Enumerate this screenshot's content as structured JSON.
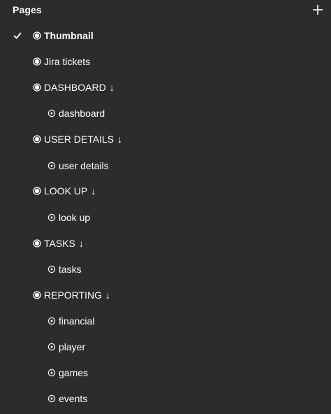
{
  "panel": {
    "title": "Pages",
    "add_icon": "plus-icon"
  },
  "items": [
    {
      "kind": "page",
      "label": "Thumbnail",
      "selected": true,
      "icon": "radio-filled-icon"
    },
    {
      "kind": "page",
      "label": "Jira tickets",
      "icon": "radio-filled-icon"
    },
    {
      "kind": "page",
      "label": "DASHBOARD",
      "arrow": "↓",
      "icon": "radio-filled-icon"
    },
    {
      "kind": "sub",
      "label": "dashboard",
      "icon": "target-icon"
    },
    {
      "kind": "page",
      "label": "USER DETAILS",
      "arrow": "↓",
      "icon": "radio-filled-icon"
    },
    {
      "kind": "sub",
      "label": "user details",
      "icon": "target-icon"
    },
    {
      "kind": "page",
      "label": "LOOK UP",
      "arrow": "↓",
      "icon": "radio-filled-icon"
    },
    {
      "kind": "sub",
      "label": "look up",
      "icon": "target-icon"
    },
    {
      "kind": "page",
      "label": "TASKS",
      "arrow": "↓",
      "icon": "radio-filled-icon"
    },
    {
      "kind": "sub",
      "label": "tasks",
      "icon": "target-icon"
    },
    {
      "kind": "page",
      "label": "REPORTING",
      "arrow": "↓",
      "icon": "radio-filled-icon"
    },
    {
      "kind": "sub",
      "label": "financial",
      "icon": "target-icon"
    },
    {
      "kind": "sub",
      "label": "player",
      "icon": "target-icon"
    },
    {
      "kind": "sub",
      "label": "games",
      "icon": "target-icon"
    },
    {
      "kind": "sub",
      "label": "events",
      "icon": "target-icon"
    }
  ],
  "colors": {
    "background": "#2c2c2c",
    "text": "#ffffff"
  }
}
